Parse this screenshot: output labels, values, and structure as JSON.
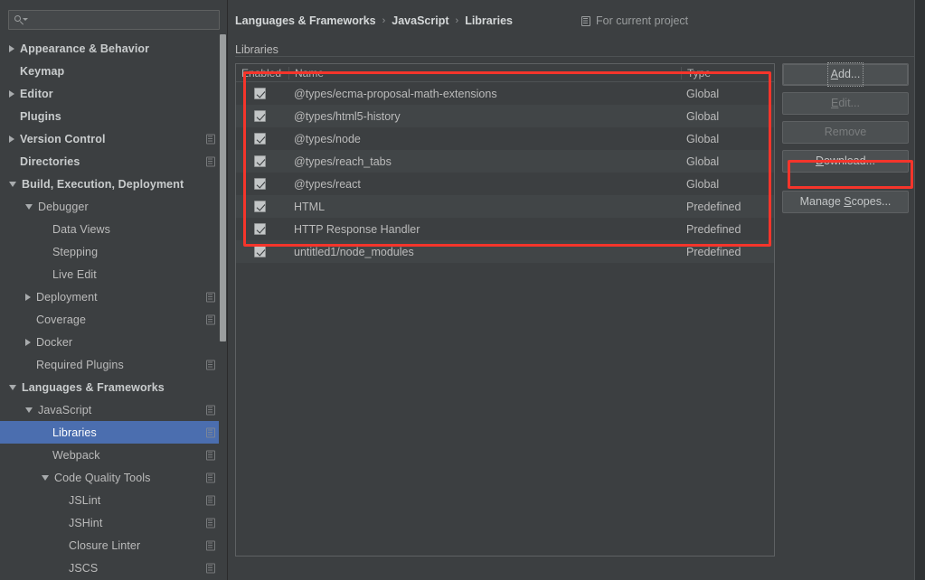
{
  "search": {
    "value": "",
    "placeholder": "",
    "icon": "search-icon"
  },
  "sidebar": {
    "items": [
      {
        "label": "Appearance & Behavior",
        "arrow": "collapsed",
        "indent": 0,
        "bold": true,
        "modIcon": false,
        "selected": false
      },
      {
        "label": "Keymap",
        "arrow": "none",
        "indent": 0,
        "bold": true,
        "modIcon": false,
        "selected": false
      },
      {
        "label": "Editor",
        "arrow": "collapsed",
        "indent": 0,
        "bold": true,
        "modIcon": false,
        "selected": false
      },
      {
        "label": "Plugins",
        "arrow": "none",
        "indent": 0,
        "bold": true,
        "modIcon": false,
        "selected": false
      },
      {
        "label": "Version Control",
        "arrow": "collapsed",
        "indent": 0,
        "bold": true,
        "modIcon": true,
        "selected": false
      },
      {
        "label": "Directories",
        "arrow": "none",
        "indent": 0,
        "bold": true,
        "modIcon": true,
        "selected": false
      },
      {
        "label": "Build, Execution, Deployment",
        "arrow": "expanded",
        "indent": 0,
        "bold": true,
        "modIcon": false,
        "selected": false
      },
      {
        "label": "Debugger",
        "arrow": "expanded",
        "indent": 1,
        "bold": false,
        "modIcon": false,
        "selected": false
      },
      {
        "label": "Data Views",
        "arrow": "none",
        "indent": 2,
        "bold": false,
        "modIcon": false,
        "selected": false
      },
      {
        "label": "Stepping",
        "arrow": "none",
        "indent": 2,
        "bold": false,
        "modIcon": false,
        "selected": false
      },
      {
        "label": "Live Edit",
        "arrow": "none",
        "indent": 2,
        "bold": false,
        "modIcon": false,
        "selected": false
      },
      {
        "label": "Deployment",
        "arrow": "collapsed",
        "indent": 1,
        "bold": false,
        "modIcon": true,
        "selected": false
      },
      {
        "label": "Coverage",
        "arrow": "none",
        "indent": 1,
        "bold": false,
        "modIcon": true,
        "selected": false
      },
      {
        "label": "Docker",
        "arrow": "collapsed",
        "indent": 1,
        "bold": false,
        "modIcon": false,
        "selected": false
      },
      {
        "label": "Required Plugins",
        "arrow": "none",
        "indent": 1,
        "bold": false,
        "modIcon": true,
        "selected": false
      },
      {
        "label": "Languages & Frameworks",
        "arrow": "expanded",
        "indent": 0,
        "bold": true,
        "modIcon": false,
        "selected": false
      },
      {
        "label": "JavaScript",
        "arrow": "expanded",
        "indent": 1,
        "bold": false,
        "modIcon": true,
        "selected": false
      },
      {
        "label": "Libraries",
        "arrow": "none",
        "indent": 2,
        "bold": false,
        "modIcon": true,
        "selected": true
      },
      {
        "label": "Webpack",
        "arrow": "none",
        "indent": 2,
        "bold": false,
        "modIcon": true,
        "selected": false
      },
      {
        "label": "Code Quality Tools",
        "arrow": "expanded",
        "indent": 2,
        "bold": false,
        "modIcon": true,
        "selected": false
      },
      {
        "label": "JSLint",
        "arrow": "none",
        "indent": 3,
        "bold": false,
        "modIcon": true,
        "selected": false
      },
      {
        "label": "JSHint",
        "arrow": "none",
        "indent": 3,
        "bold": false,
        "modIcon": true,
        "selected": false
      },
      {
        "label": "Closure Linter",
        "arrow": "none",
        "indent": 3,
        "bold": false,
        "modIcon": true,
        "selected": false
      },
      {
        "label": "JSCS",
        "arrow": "none",
        "indent": 3,
        "bold": false,
        "modIcon": true,
        "selected": false
      }
    ]
  },
  "breadcrumb": {
    "items": [
      "Languages & Frameworks",
      "JavaScript",
      "Libraries"
    ],
    "separator": "›"
  },
  "scope_note": {
    "label": "For current project",
    "icon": "module-icon"
  },
  "group": {
    "label": "Libraries"
  },
  "table": {
    "columns": [
      "Enabled",
      "Name",
      "Type"
    ],
    "rows": [
      {
        "enabled": true,
        "name": "@types/ecma-proposal-math-extensions",
        "type": "Global"
      },
      {
        "enabled": true,
        "name": "@types/html5-history",
        "type": "Global"
      },
      {
        "enabled": true,
        "name": "@types/node",
        "type": "Global"
      },
      {
        "enabled": true,
        "name": "@types/reach_tabs",
        "type": "Global"
      },
      {
        "enabled": true,
        "name": "@types/react",
        "type": "Global"
      },
      {
        "enabled": true,
        "name": "HTML",
        "type": "Predefined"
      },
      {
        "enabled": true,
        "name": "HTTP Response Handler",
        "type": "Predefined"
      },
      {
        "enabled": true,
        "name": "untitled1/node_modules",
        "type": "Predefined"
      }
    ]
  },
  "buttons": [
    {
      "pre": "",
      "mnemonic": "A",
      "post": "dd...",
      "label": "Add...",
      "disabled": false,
      "focused": true,
      "name": "add-button"
    },
    {
      "pre": "",
      "mnemonic": "E",
      "post": "dit...",
      "label": "Edit...",
      "disabled": true,
      "focused": false,
      "name": "edit-button"
    },
    {
      "pre": "Remove",
      "mnemonic": "",
      "post": "",
      "label": "Remove",
      "disabled": true,
      "focused": false,
      "name": "remove-button"
    },
    {
      "pre": "",
      "mnemonic": "D",
      "post": "ownload...",
      "label": "Download...",
      "disabled": false,
      "focused": false,
      "name": "download-button"
    },
    {
      "pre": "Manage ",
      "mnemonic": "S",
      "post": "copes...",
      "label": "Manage Scopes...",
      "disabled": false,
      "focused": false,
      "name": "manage-scopes-button"
    }
  ],
  "annotations": {
    "color": "#f5352b",
    "boxes": [
      {
        "target": "libraries-table-rows"
      },
      {
        "target": "download-button"
      }
    ]
  },
  "theme": {
    "background": "#3c3f41",
    "selection": "#4b6eaf",
    "text": "#bbbbbb",
    "border": "#5e6163",
    "accent": "#f5352b"
  }
}
